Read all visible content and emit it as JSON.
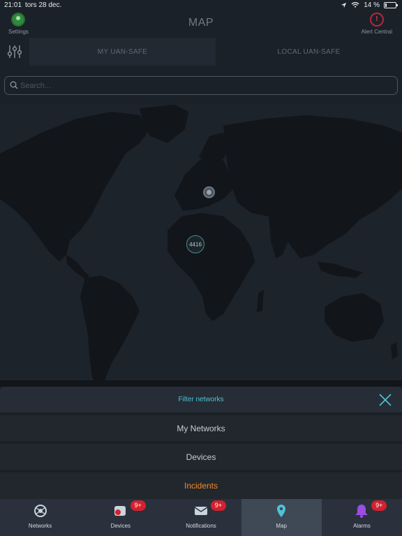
{
  "status_bar": {
    "time": "21:01",
    "date": "tors 28 dec.",
    "battery": "14 %",
    "battery_level": 0.14
  },
  "header": {
    "title": "MAP",
    "settings_label": "Settings",
    "alert_label": "Alert Central"
  },
  "segments": [
    {
      "label": "MY UAN-SAFE",
      "active": true
    },
    {
      "label": "LOCAL UAN-SAFE",
      "active": false
    }
  ],
  "search": {
    "placeholder": "Search...",
    "value": ""
  },
  "map": {
    "cluster_count": "4416"
  },
  "filter": {
    "title": "Filter networks",
    "options": [
      {
        "label": "My Networks",
        "selected": false
      },
      {
        "label": "Devices",
        "selected": false
      },
      {
        "label": "Incidents",
        "selected": true
      }
    ]
  },
  "tabbar": {
    "items": [
      {
        "label": "Networks",
        "icon": "networks-icon",
        "badge": ""
      },
      {
        "label": "Devices",
        "icon": "devices-icon",
        "badge": "9+"
      },
      {
        "label": "Notifications",
        "icon": "mail-icon",
        "badge": "9+"
      },
      {
        "label": "Map",
        "icon": "map-pin-icon",
        "badge": "",
        "active": true
      },
      {
        "label": "Alarms",
        "icon": "bell-icon",
        "badge": "9+"
      }
    ]
  },
  "colors": {
    "accent": "#4fc3d6",
    "incidents": "#f08a24",
    "badge": "#d3212f",
    "background": "#1b2129"
  }
}
